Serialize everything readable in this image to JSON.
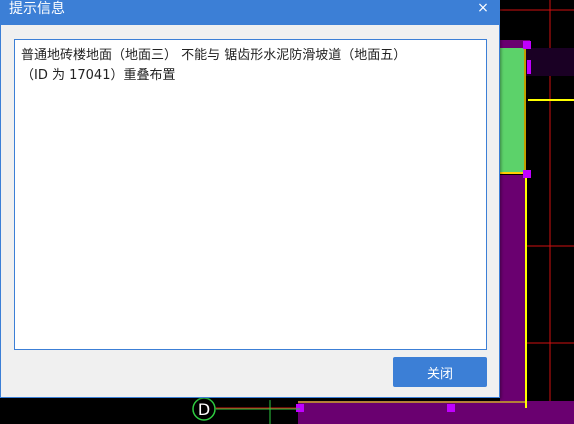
{
  "dialog": {
    "title": "提示信息",
    "close_glyph": "×",
    "message": "普通地砖楼地面（地面三） 不能与 锯齿形水泥防滑坡道（地面五）\n（ID 为 17041）重叠布置",
    "close_button_label": "关闭"
  },
  "cad": {
    "axis_label": "D"
  },
  "colors": {
    "accent": "#3c7fd6",
    "dialog_bg": "#f0f0f0",
    "cad_bg": "#000000",
    "wall_purple": "#6a0070",
    "green_room": "#5cd26a",
    "grid_red": "#d01010",
    "line_yellow": "#ffff00"
  }
}
